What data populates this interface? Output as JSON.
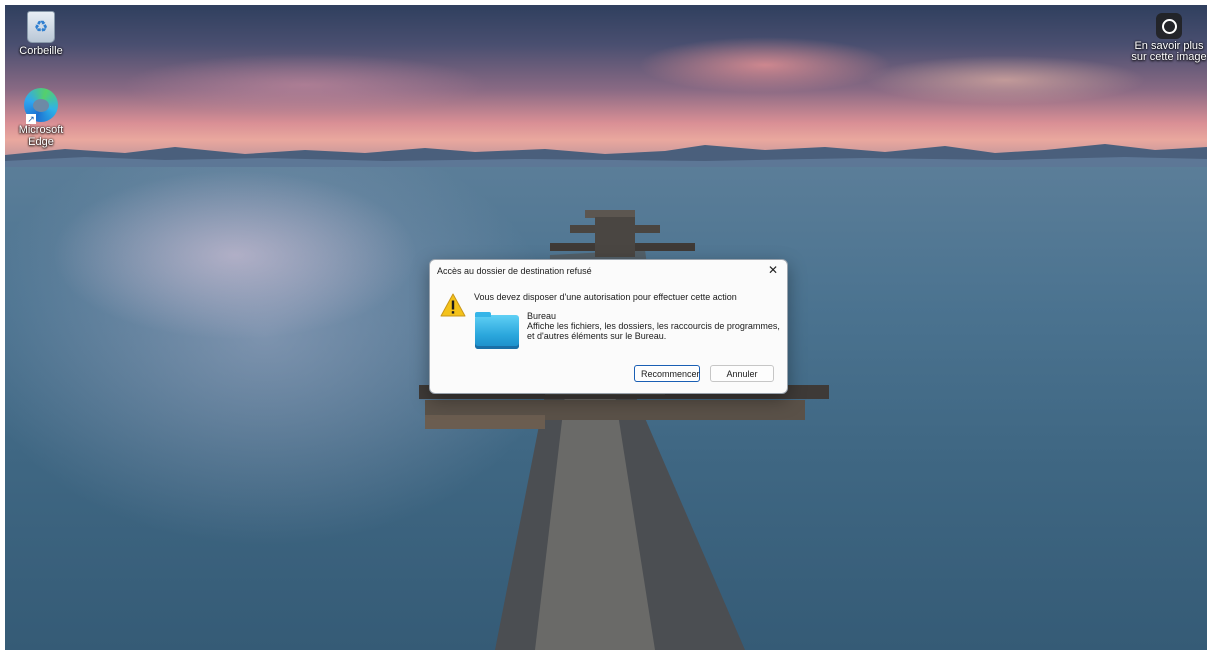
{
  "desktop": {
    "icons": [
      {
        "label": "Corbeille",
        "icon": "recycle-bin-icon"
      },
      {
        "label": "Microsoft Edge",
        "icon": "edge-icon"
      }
    ],
    "info_widget": {
      "label": "En savoir plus sur cette image",
      "icon": "info-camera-icon"
    }
  },
  "dialog": {
    "title": "Accès au dossier de destination refusé",
    "message": "Vous devez disposer d'une autorisation pour effectuer cette action",
    "item_name": "Bureau",
    "item_description": "Affiche les fichiers, les dossiers, les raccourcis de programmes, et d'autres éléments sur le Bureau.",
    "retry_label": "Recommencer",
    "cancel_label": "Annuler",
    "close_symbol": "✕",
    "warning_icon": "warning-icon",
    "folder_icon": "desktop-folder-icon"
  }
}
